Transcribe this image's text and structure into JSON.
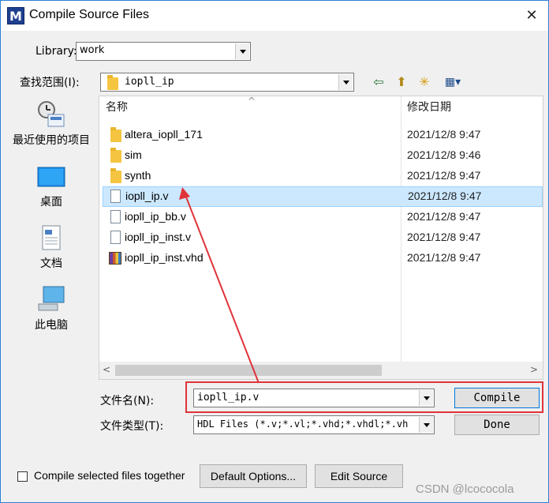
{
  "window": {
    "title": "Compile Source Files",
    "app_icon_glyph": "M",
    "close_glyph": "✕"
  },
  "library": {
    "label": "Library:",
    "value": "work"
  },
  "lookin": {
    "label": "查找范围(I):",
    "value": "iopll_ip"
  },
  "toolbar": {
    "back_glyph": "⇦",
    "up_glyph": "⬆",
    "newfolder_glyph": "✳",
    "view_glyph": "▦▾"
  },
  "places": [
    {
      "label": "最近使用的项目",
      "icon": "recent-icon"
    },
    {
      "label": "桌面",
      "icon": "desktop-icon"
    },
    {
      "label": "文档",
      "icon": "documents-icon"
    },
    {
      "label": "此电脑",
      "icon": "computer-icon"
    }
  ],
  "filelist": {
    "col_name": "名称",
    "col_date": "修改日期",
    "sort_glyph": "^",
    "rows": [
      {
        "name": "altera_iopll_171",
        "date": "2021/12/8 9:47",
        "icon": "folder-icon"
      },
      {
        "name": "sim",
        "date": "2021/12/8 9:46",
        "icon": "folder-icon"
      },
      {
        "name": "synth",
        "date": "2021/12/8 9:47",
        "icon": "folder-icon"
      },
      {
        "name": "iopll_ip.v",
        "date": "2021/12/8 9:47",
        "icon": "file-icon",
        "selected": true
      },
      {
        "name": "iopll_ip_bb.v",
        "date": "2021/12/8 9:47",
        "icon": "file-icon"
      },
      {
        "name": "iopll_ip_inst.v",
        "date": "2021/12/8 9:47",
        "icon": "file-icon"
      },
      {
        "name": "iopll_ip_inst.vhd",
        "date": "2021/12/8 9:47",
        "icon": "vhd-file-icon"
      }
    ],
    "scroll_left": "<",
    "scroll_right": ">"
  },
  "filename": {
    "label": "文件名(N):",
    "value": "iopll_ip.v"
  },
  "filetype": {
    "label": "文件类型(T):",
    "value": "HDL Files (*.v;*.vl;*.vhd;*.vhdl;*.vh"
  },
  "buttons": {
    "compile": "Compile",
    "done": "Done",
    "default_options": "Default Options...",
    "edit_source": "Edit Source"
  },
  "compile_together": {
    "label": "Compile selected files together",
    "checked": false
  },
  "watermark": "CSDN @lcococola",
  "colors": {
    "annotation_red": "#e0333a",
    "selection": "#cce8ff"
  }
}
